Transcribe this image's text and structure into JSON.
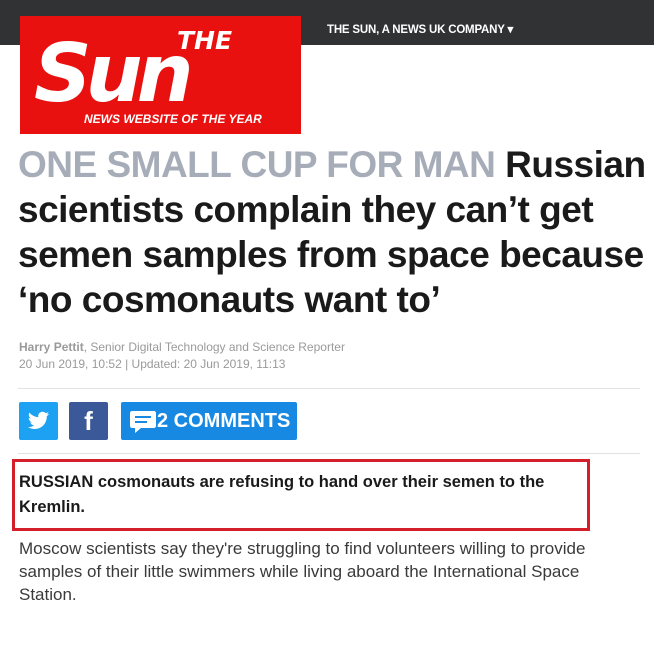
{
  "header": {
    "network_link": "THE SUN, A NEWS UK COMPANY ▾",
    "logo": {
      "the": "THE",
      "brand": "Sun",
      "tagline": "NEWS WEBSITE OF THE YEAR"
    }
  },
  "article": {
    "kicker": "ONE SMALL CUP FOR MAN",
    "title": " Russian scientists complain they can’t get semen samples from space because ‘no cosmonauts want to’",
    "author": "Harry Pettit",
    "author_role": ", Senior Digital Technology and Science Reporter",
    "dateline": "20 Jun 2019, 10:52 | Updated: 20 Jun 2019, 11:13",
    "lead": "RUSSIAN cosmonauts are refusing to hand over their semen to the Kremlin.",
    "body": "Moscow scientists say they're struggling to find volunteers willing to provide samples of their little swimmers while living aboard the International Space Station."
  },
  "share": {
    "twitter_icon": "twitter-icon",
    "facebook_glyph": "f",
    "comments_label": "2 COMMENTS"
  },
  "colors": {
    "brand_red": "#e8110f",
    "topbar": "#303233",
    "twitter": "#1da1f2",
    "facebook": "#3b5998",
    "comments": "#1789e3",
    "highlight_box": "#d41e29",
    "kicker": "#a7adb8"
  }
}
